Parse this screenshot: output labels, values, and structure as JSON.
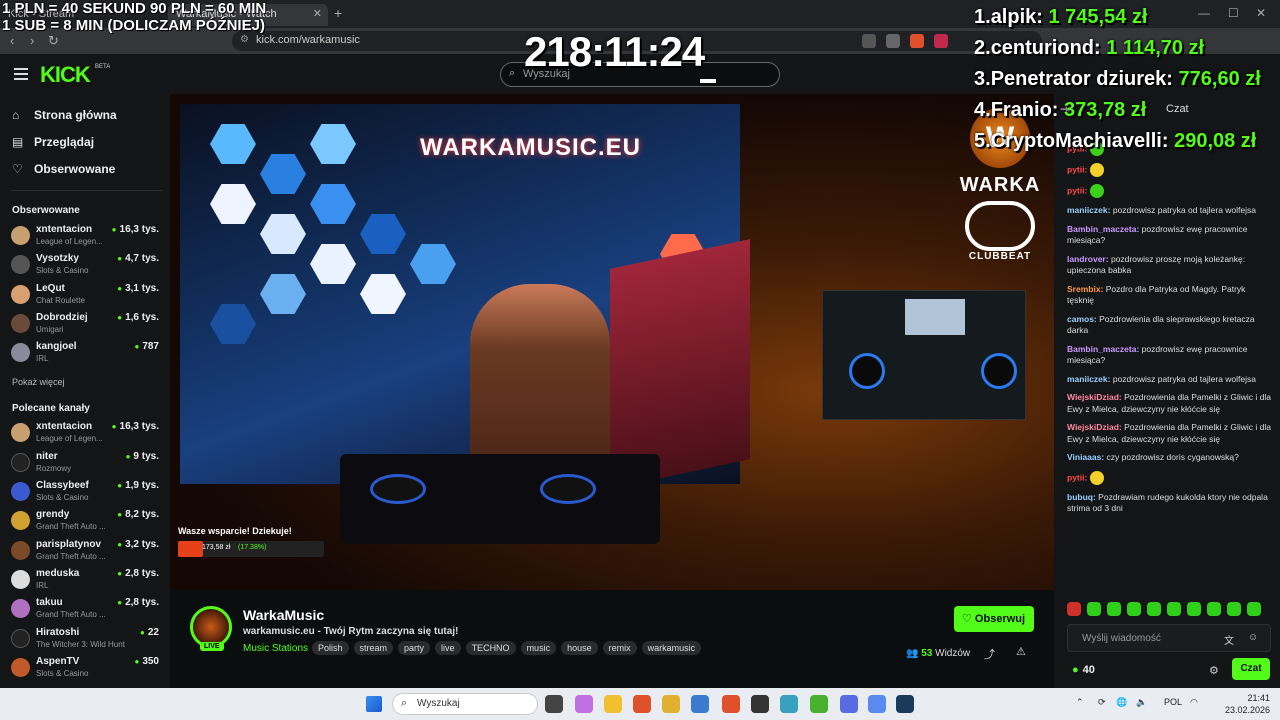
{
  "browser": {
    "tabs": [
      {
        "label": "Kick • Stream"
      },
      {
        "label": "WarkaMusic - Watch"
      }
    ],
    "new_tab": "+",
    "url": "kick.com/warkamusic"
  },
  "kick": {
    "logo": "KICK",
    "beta": "BETA",
    "search_placeholder": "Wyszukaj"
  },
  "sidebar": {
    "nav": [
      {
        "label": "Strona główna",
        "icon": "home-icon"
      },
      {
        "label": "Przeglądaj",
        "icon": "browse-icon"
      },
      {
        "label": "Obserwowane",
        "icon": "heart-icon"
      }
    ],
    "followed_heading": "Obserwowane",
    "followed": [
      {
        "name": "xntentacion",
        "category": "League of Legen...",
        "viewers": "16,3 tys.",
        "color": "#c8a070"
      },
      {
        "name": "Vysotzky",
        "category": "Slots & Casino",
        "viewers": "4,7 tys.",
        "color": "#555"
      },
      {
        "name": "LeQut",
        "category": "Chat Roulette",
        "viewers": "3,1 tys.",
        "color": "#d8a070"
      },
      {
        "name": "Dobrodziej",
        "category": "Umigari",
        "viewers": "1,6 tys.",
        "color": "#6a4a3a"
      },
      {
        "name": "kangjoel",
        "category": "IRL",
        "viewers": "787",
        "color": "#8a8a9a"
      }
    ],
    "show_more": "Pokaż więcej",
    "recommended_heading": "Polecane kanały",
    "recommended": [
      {
        "name": "xntentacion",
        "category": "League of Legen...",
        "viewers": "16,3 tys.",
        "color": "#c8a070"
      },
      {
        "name": "niter",
        "category": "Rozmowy",
        "viewers": "9 tys.",
        "color": "#222"
      },
      {
        "name": "Classybeef",
        "category": "Slots & Casino",
        "viewers": "1,9 tys.",
        "color": "#3a5ad0"
      },
      {
        "name": "grendy",
        "category": "Grand Theft Auto ...",
        "viewers": "8,2 tys.",
        "color": "#d0a030"
      },
      {
        "name": "parisplatynov",
        "category": "Grand Theft Auto ...",
        "viewers": "3,2 tys.",
        "color": "#7a4a2a"
      },
      {
        "name": "meduska",
        "category": "IRL",
        "viewers": "2,8 tys.",
        "color": "#ddd"
      },
      {
        "name": "takuu",
        "category": "Grand Theft Auto ...",
        "viewers": "2,8 tys.",
        "color": "#b070c0"
      },
      {
        "name": "Hiratoshi",
        "category": "The Witcher 3: Wild Hunt",
        "viewers": "22",
        "color": "#222"
      },
      {
        "name": "AspenTV",
        "category": "Slots & Casino",
        "viewers": "350",
        "color": "#c05a2a"
      }
    ]
  },
  "overlay": {
    "rules": [
      "1 PLN =  40 SEKUND 90 PLN = 60 MIN",
      "1 SUB = 8 MIN (DOLICZAM PÓŹNIEJ)"
    ],
    "timer": "218:11:24",
    "leaderboard": [
      {
        "rank": "1.",
        "name": "alpik:",
        "amount": "1 745,54 zł"
      },
      {
        "rank": "2.",
        "name": "centuriond:",
        "amount": "1 114,70 zł"
      },
      {
        "rank": "3.",
        "name": "Penetrator dziurek:",
        "amount": "776,60 zł"
      },
      {
        "rank": "4.",
        "name": "Franio:",
        "amount": "373,78 zł"
      },
      {
        "rank": "5.",
        "name": "CryptoMachiavelli:",
        "amount": "290,08 zł"
      }
    ]
  },
  "video": {
    "sign": "WARKAMUSIC.EU",
    "logo_name": "WARKA",
    "logo_sub": "CLUBBEAT",
    "support_label": "Wasze wsparcie! Dziekuje!",
    "support_amount": "173,58 zł",
    "support_pct": "(17.38%)",
    "support_fraction": 0.1738
  },
  "stream": {
    "streamer": "WarkaMusic",
    "live": "LIVE",
    "title": "warkamusic.eu - Twój Rytm zaczyna się tutaj!",
    "category": "Music Stations",
    "tags": [
      "Polish",
      "stream",
      "party",
      "live",
      "TECHNO",
      "music",
      "house",
      "remix",
      "warkamusic"
    ],
    "follow": "Obserwuj",
    "viewers_count": "53",
    "viewers_label": "Widzów"
  },
  "chat": {
    "title": "Czat",
    "messages": [
      {
        "user": "pytii:",
        "text": "",
        "emote": "green",
        "color": "#ff4a4a"
      },
      {
        "user": "pytii:",
        "text": "",
        "emote": "yellow",
        "color": "#ff4a4a"
      },
      {
        "user": "pytii:",
        "text": "",
        "emote": "green",
        "color": "#ff4a4a"
      },
      {
        "user": "maniiczek:",
        "text": "pozdrowisz patryka od tajlera wolfejsa",
        "emote": "",
        "color": "#9ad0ff"
      },
      {
        "user": "Bambin_maczeta:",
        "text": "pozdrowisz ewę pracownice miesiąca?",
        "emote": "",
        "color": "#c89aff"
      },
      {
        "user": "landrover:",
        "text": "pozdrowisz proszę moją koleżankę: upieczona babka",
        "emote": "",
        "color": "#c89aff"
      },
      {
        "user": "Srembix:",
        "text": "Pozdro dla Patryka od Magdy. Patryk tęsknię",
        "emote": "",
        "color": "#ff9a4a"
      },
      {
        "user": "camos:",
        "text": "Pozdrowienia dla sieprawskiego kretacza darka",
        "emote": "",
        "color": "#9ad0ff"
      },
      {
        "user": "Bambin_maczeta:",
        "text": "pozdrowisz ewę pracownice miesiąca?",
        "emote": "",
        "color": "#c89aff"
      },
      {
        "user": "maniiczek:",
        "text": "pozdrowisz patryka od tajlera wolfejsa",
        "emote": "",
        "color": "#9ad0ff"
      },
      {
        "user": "WiejskiDziad:",
        "text": "Pozdrowienia dla Pamelki z Gliwic i dla Ewy z Mielca, dziewczyny nie kłóćcie się",
        "emote": "",
        "color": "#ff8aa0"
      },
      {
        "user": "WiejskiDziad:",
        "text": "Pozdrowienia dla Pamelki z Gliwic i dla Ewy z Mielca, dziewczyny nie kłóćcie się",
        "emote": "",
        "color": "#ff8aa0"
      },
      {
        "user": "Viniaaas:",
        "text": "czy pozdrowisz doris cyganowską?",
        "emote": "",
        "color": "#9ad0ff"
      },
      {
        "user": "pytii:",
        "text": "",
        "emote": "yellow",
        "color": "#ff4a4a"
      },
      {
        "user": "bubuq:",
        "text": "Pozdrawiam rudego kukolda ktory nie odpala strima od 3 dni",
        "emote": "",
        "color": "#9ad0ff"
      }
    ],
    "input_placeholder": "Wyślij wiadomość",
    "points": "40",
    "send": "Czat"
  },
  "taskbar": {
    "search_placeholder": "Wyszukaj",
    "lang": "POL",
    "time": "21:41",
    "date": "23.02.2026"
  }
}
